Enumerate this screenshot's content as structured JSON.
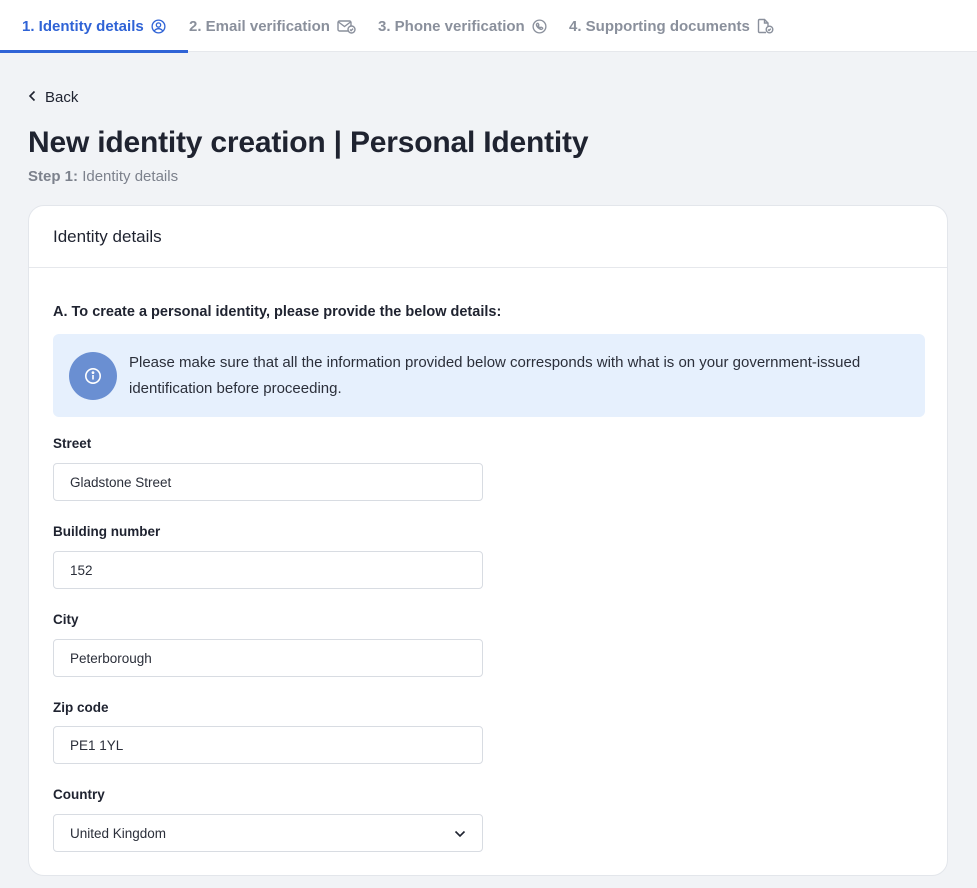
{
  "stepper": {
    "steps": [
      {
        "label": "1. Identity details",
        "icon": "user-circle-icon",
        "active": true
      },
      {
        "label": "2. Email verification",
        "icon": "mail-check-icon",
        "active": false
      },
      {
        "label": "3. Phone verification",
        "icon": "phone-icon",
        "active": false
      },
      {
        "label": "4. Supporting documents",
        "icon": "document-check-icon",
        "active": false
      }
    ],
    "accent_color": "#2f63d6"
  },
  "header": {
    "back_label": "Back",
    "title": "New identity creation | Personal Identity",
    "step_prefix": "Step 1:",
    "step_name": "Identity details"
  },
  "card": {
    "title": "Identity details",
    "section_title": "A. To create a personal identity, please provide the below details:",
    "notice": "Please make sure that all the information provided below corresponds with what is on your government-issued identification before proceeding."
  },
  "form": {
    "street": {
      "label": "Street",
      "value": "Gladstone Street"
    },
    "building_number": {
      "label": "Building number",
      "value": "152"
    },
    "city": {
      "label": "City",
      "value": "Peterborough"
    },
    "zip_code": {
      "label": "Zip code",
      "value": "PE1 1YL"
    },
    "country": {
      "label": "Country",
      "value": "United Kingdom"
    }
  }
}
